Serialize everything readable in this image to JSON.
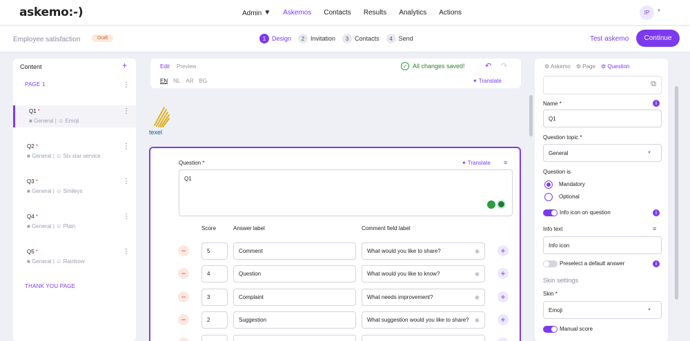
{
  "app": {
    "logo": "askemo:-)",
    "avatar_initials": "IP"
  },
  "nav": {
    "items": [
      {
        "label": "Admin",
        "caret": "▼",
        "active": false
      },
      {
        "label": "Askemos",
        "active": true
      },
      {
        "label": "Contacts",
        "active": false
      },
      {
        "label": "Results",
        "active": false
      },
      {
        "label": "Analytics",
        "active": false
      },
      {
        "label": "Actions",
        "active": false
      }
    ]
  },
  "survey": {
    "title": "Employee satisfaction",
    "status": "Draft"
  },
  "steps": [
    {
      "num": "1",
      "label": "Design",
      "active": true
    },
    {
      "num": "2",
      "label": "Invitation",
      "active": false
    },
    {
      "num": "3",
      "label": "Contacts",
      "active": false
    },
    {
      "num": "4",
      "label": "Send",
      "active": false
    }
  ],
  "actions": {
    "test": "Test askemo",
    "continue": "Continue"
  },
  "content": {
    "header": "Content",
    "page1": "PAGE 1",
    "thank_you": "THANK YOU PAGE",
    "questions": [
      {
        "title": "Q1",
        "sub": "General | ☺ Emoji"
      },
      {
        "title": "Q2",
        "sub": "General | ☺ Six star service"
      },
      {
        "title": "Q3",
        "sub": "General | ☺ Smileys"
      },
      {
        "title": "Q4",
        "sub": "General | ☺ Plain"
      },
      {
        "title": "Q5",
        "sub": "General | ☺ Rainbow"
      }
    ]
  },
  "editor": {
    "tab_edit": "Edit",
    "tab_preview": "Preview",
    "saved": "All changes saved!",
    "langs": [
      "EN",
      "NL",
      "AR",
      "BG"
    ],
    "translate": "Translate",
    "question_label": "Question *",
    "question_text": "Q1",
    "col_score": "Score",
    "col_answer": "Answer label",
    "col_comment": "Comment field label",
    "rows": [
      {
        "score": "5",
        "answer": "Comment",
        "comment": "What would you like to share?"
      },
      {
        "score": "4",
        "answer": "Question",
        "comment": "What would you like to know?"
      },
      {
        "score": "3",
        "answer": "Complaint",
        "comment": "What needs improvement?"
      },
      {
        "score": "2",
        "answer": "Suggestion",
        "comment": "What suggestion would you like to share?"
      },
      {
        "score": "",
        "answer": "",
        "comment": ""
      }
    ]
  },
  "company_logo": {
    "text": "texel"
  },
  "props": {
    "tabs": [
      "Askemo",
      "Page",
      "Question"
    ],
    "name_label": "Name *",
    "name_value": "Q1",
    "topic_label": "Question topic *",
    "topic_value": "General",
    "question_is_label": "Question is",
    "mandatory": "Mandatory",
    "optional": "Optional",
    "info_icon_toggle": "Info icon on question",
    "info_text_label": "Info text",
    "info_text_value": "Info icon",
    "preselect": "Preselect a default answer",
    "skin_settings": "Skin settings",
    "skin_label": "Skin *",
    "skin_value": "Emoji",
    "manual_score": "Manual score"
  },
  "colors": {
    "accent": "#7c3aed",
    "saved": "#2e7d32",
    "required": "#e5484d"
  }
}
